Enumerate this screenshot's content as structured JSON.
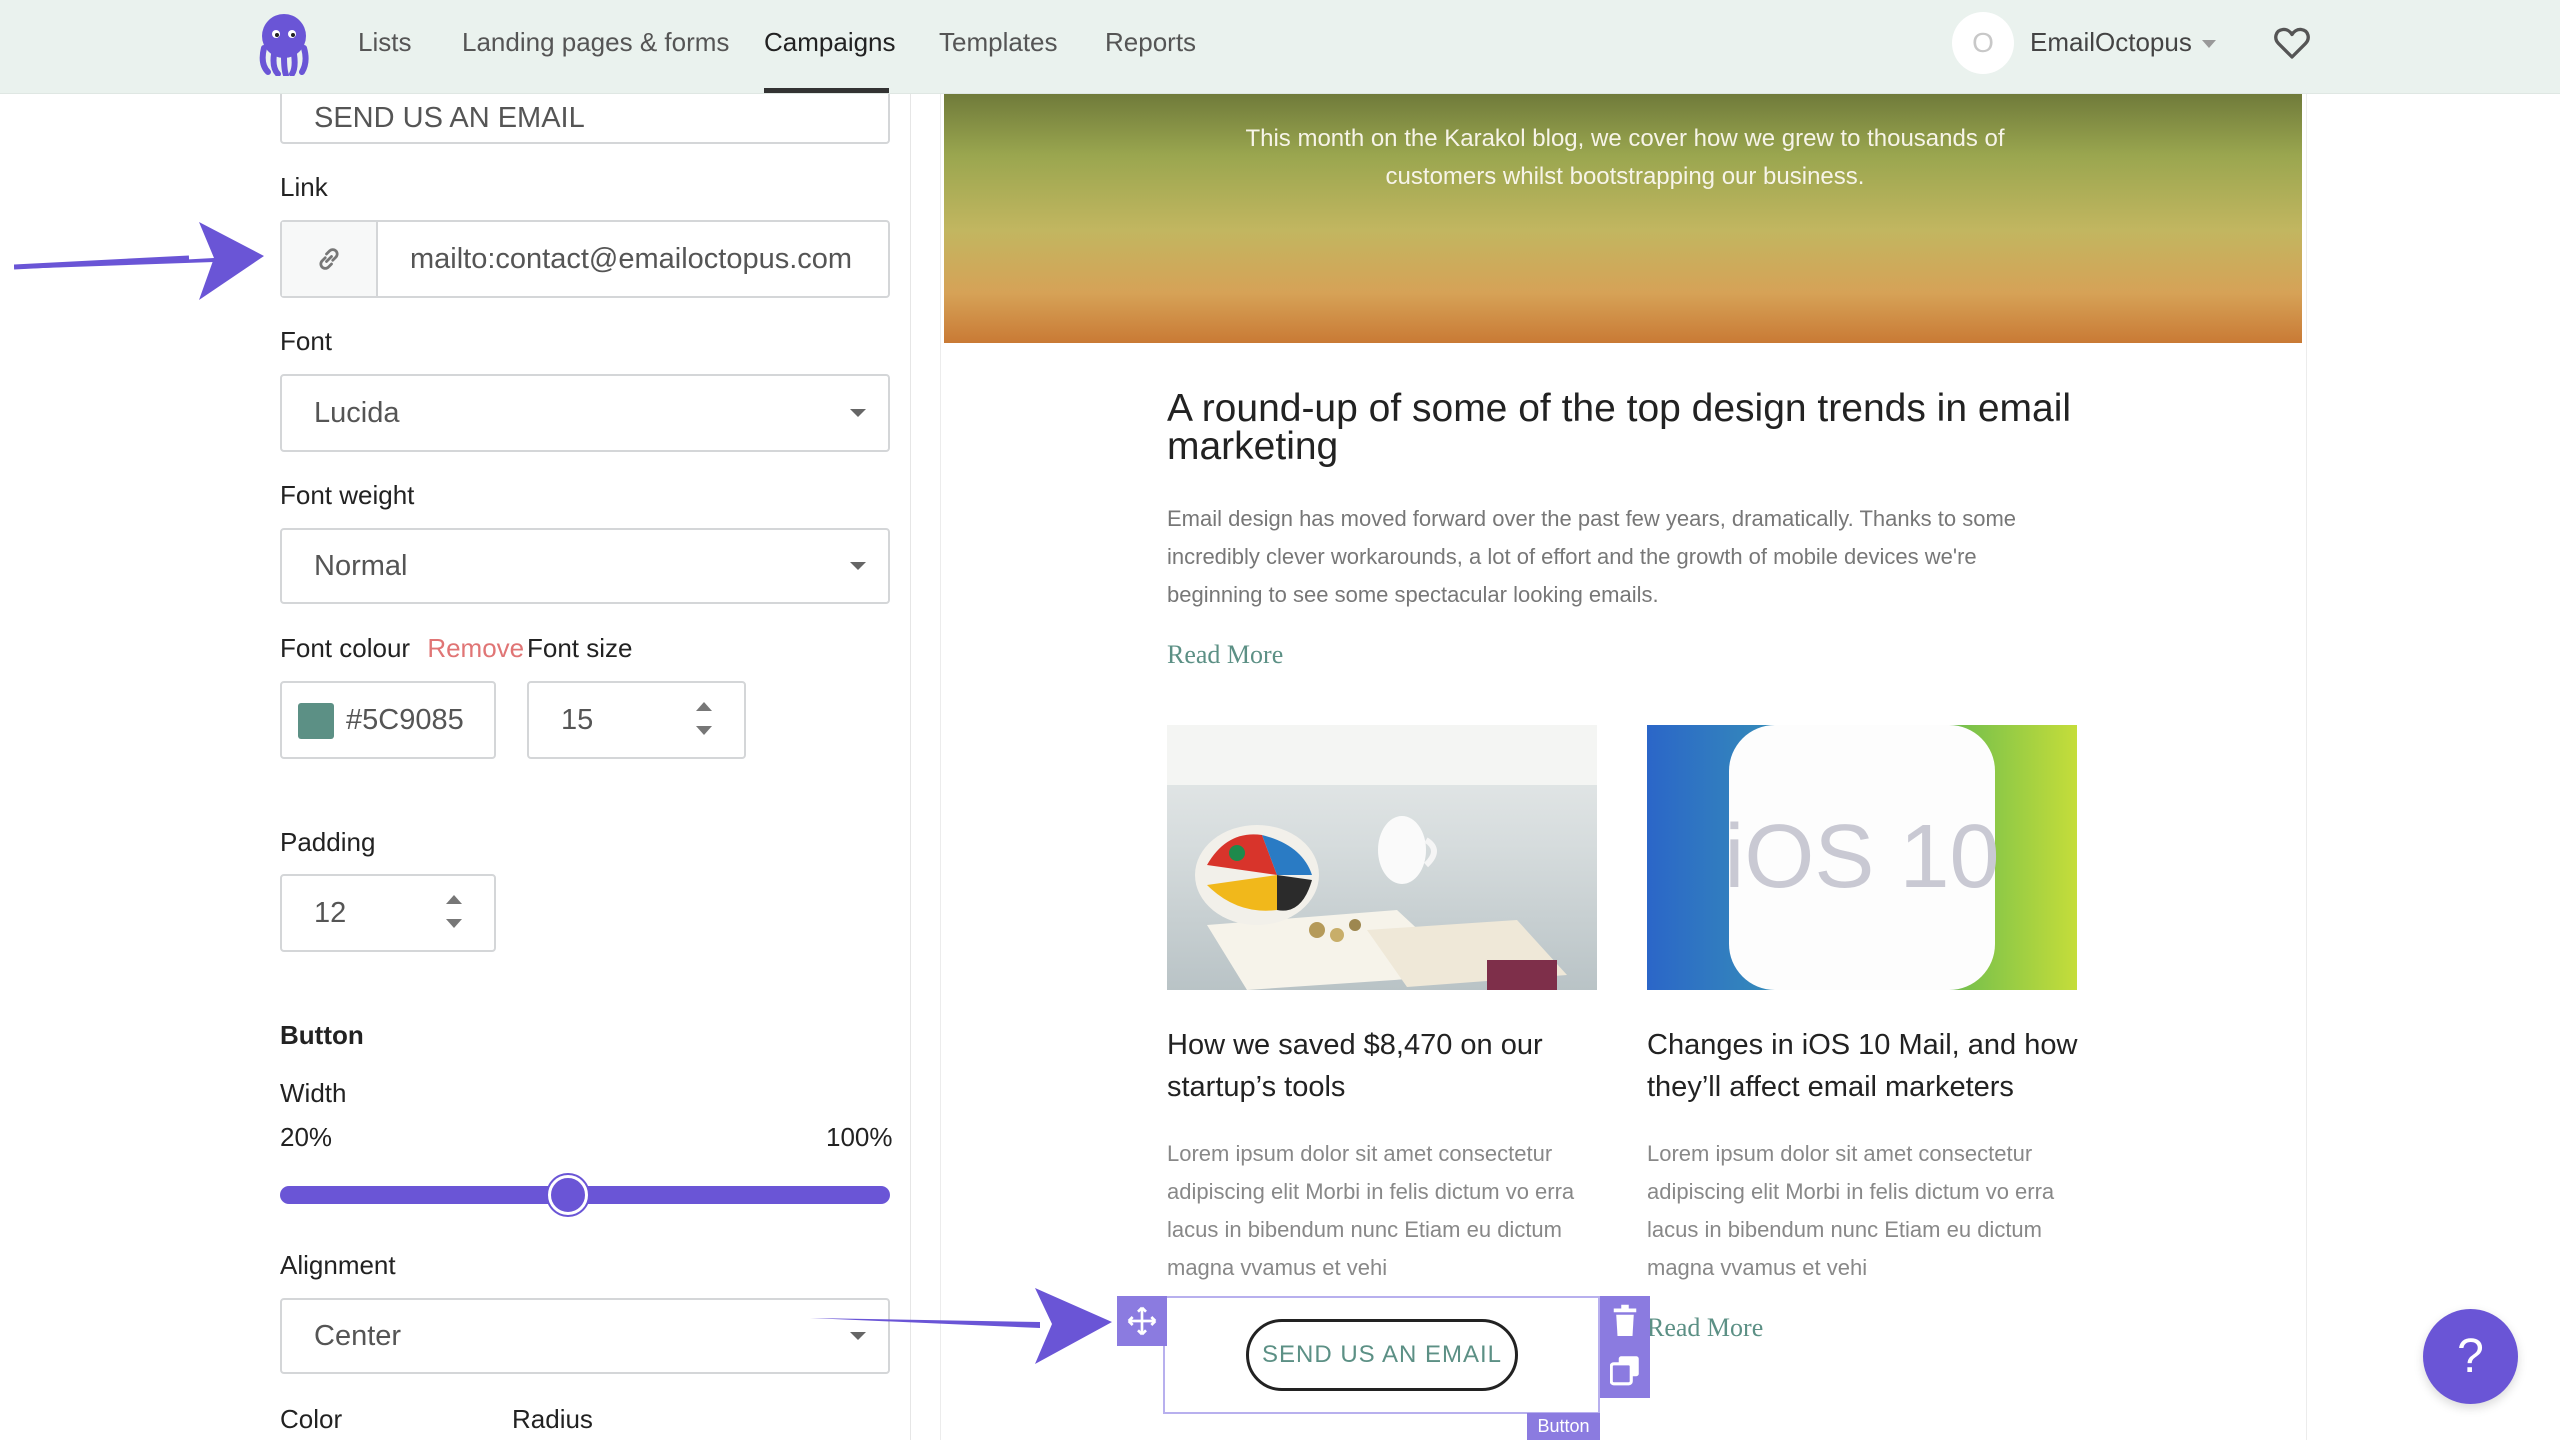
{
  "nav": {
    "items": [
      {
        "label": "Lists"
      },
      {
        "label": "Landing pages & forms"
      },
      {
        "label": "Campaigns"
      },
      {
        "label": "Templates"
      },
      {
        "label": "Reports"
      }
    ],
    "avatar_initial": "O",
    "account_name": "EmailOctopus"
  },
  "editor": {
    "button_text_value": "SEND US AN EMAIL",
    "link": {
      "label": "Link",
      "value": "mailto:contact@emailoctopus.com"
    },
    "font": {
      "label": "Font",
      "value": "Lucida"
    },
    "font_weight": {
      "label": "Font weight",
      "value": "Normal"
    },
    "font_colour": {
      "label": "Font colour",
      "remove_label": "Remove",
      "value": "#5C9085",
      "swatch": "#5c9085"
    },
    "font_size": {
      "label": "Font size",
      "value": "15"
    },
    "padding": {
      "label": "Padding",
      "value": "12"
    },
    "button_section": {
      "heading": "Button",
      "width_label": "Width",
      "min_label": "20%",
      "max_label": "100%",
      "width_fraction": 0.47
    },
    "alignment": {
      "label": "Alignment",
      "value": "Center"
    },
    "color_label": "Color",
    "radius_label": "Radius"
  },
  "preview": {
    "hero_text": "This month on the Karakol blog, we cover how we grew to thousands of customers whilst bootstrapping our business.",
    "article_title": "A round-up of some of the top design trends in email marketing",
    "article_body": "Email design has moved forward over the past few years, dramatically. Thanks to some incredibly clever workarounds, a lot of effort and the growth of mobile devices we're beginning to see some spectacular looking emails.",
    "read_more": "Read More",
    "col1": {
      "title": "How we saved $8,470 on our startup’s tools",
      "body": "Lorem ipsum dolor sit amet consectetur adipiscing elit Morbi in felis dictum vo erra lacus in bibendum nunc Etiam eu dictum magna vvamus et vehi"
    },
    "col2": {
      "image_text": "iOS 10",
      "title": "Changes in iOS 10 Mail, and how they’ll affect email marketers",
      "body": "Lorem ipsum dolor sit amet consectetur adipiscing elit Morbi in felis dictum vo erra lacus in bibendum nunc Etiam eu dictum magna vvamus et vehi",
      "read_more": "Read More"
    },
    "button_label": "SEND US AN EMAIL",
    "block_tag": "Button"
  },
  "help_label": "?",
  "colors": {
    "accent": "#6a55d6",
    "link_green": "#5c9085",
    "remove": "#e07575"
  }
}
